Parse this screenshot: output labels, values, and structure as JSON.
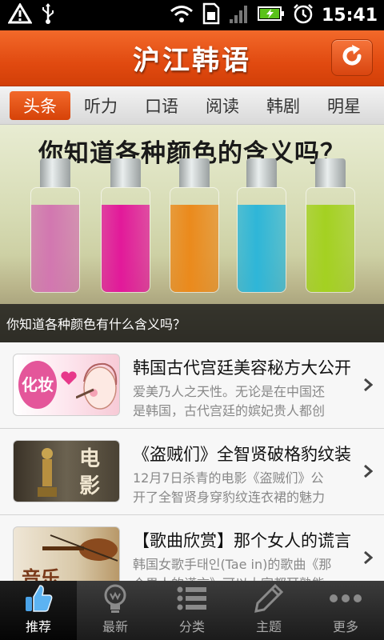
{
  "status_bar": {
    "time": "15:41",
    "icons": [
      "warning-icon",
      "usb-icon",
      "wifi-icon",
      "sim-icon",
      "signal-icon",
      "battery-charging-icon",
      "alarm-icon"
    ]
  },
  "header": {
    "title": "沪江韩语",
    "refresh_icon": "refresh-icon"
  },
  "tabs": [
    {
      "label": "头条",
      "active": true
    },
    {
      "label": "听力",
      "active": false
    },
    {
      "label": "口语",
      "active": false
    },
    {
      "label": "阅读",
      "active": false
    },
    {
      "label": "韩剧",
      "active": false
    },
    {
      "label": "明星",
      "active": false
    }
  ],
  "banner": {
    "headline": "你知道各种颜色的含义吗？",
    "caption": "你知道各种颜色有什么含义吗？",
    "bottle_colors": [
      "#d277b0",
      "#e2199a",
      "#eb8a1c",
      "#2eb6d8",
      "#a4d121"
    ]
  },
  "articles": [
    {
      "title": "韩国古代宫廷美容秘方大公开",
      "desc_line1": "爱美乃人之天性。无论是在中国还",
      "desc_line2": "是韩国，古代宫廷的嫔妃贵人都创",
      "thumb_text": "化妆"
    },
    {
      "title": "《盗贼们》全智贤破格豹纹装",
      "desc_line1": "12月7日杀青的电影《盗贼们》公",
      "desc_line2": "开了全智贤身穿豹纹连衣裙的魅力",
      "thumb_text": "电影"
    },
    {
      "title": "【歌曲欣赏】那个女人的谎言",
      "desc_line1": "韩国女歌手태인(Tae in)的歌曲《那",
      "desc_line2": "个男人的谎言》可以大家都耳熟能",
      "thumb_text": "音乐"
    }
  ],
  "bottom_nav": [
    {
      "label": "推荐",
      "icon": "thumbs-up-icon",
      "active": true
    },
    {
      "label": "最新",
      "icon": "lightbulb-icon",
      "active": false
    },
    {
      "label": "分类",
      "icon": "list-icon",
      "active": false
    },
    {
      "label": "主题",
      "icon": "pen-icon",
      "active": false
    },
    {
      "label": "更多",
      "icon": "more-dots-icon",
      "active": false
    }
  ],
  "colors": {
    "accent": "#e1501a",
    "nav_bg": "#2a2a2a"
  }
}
